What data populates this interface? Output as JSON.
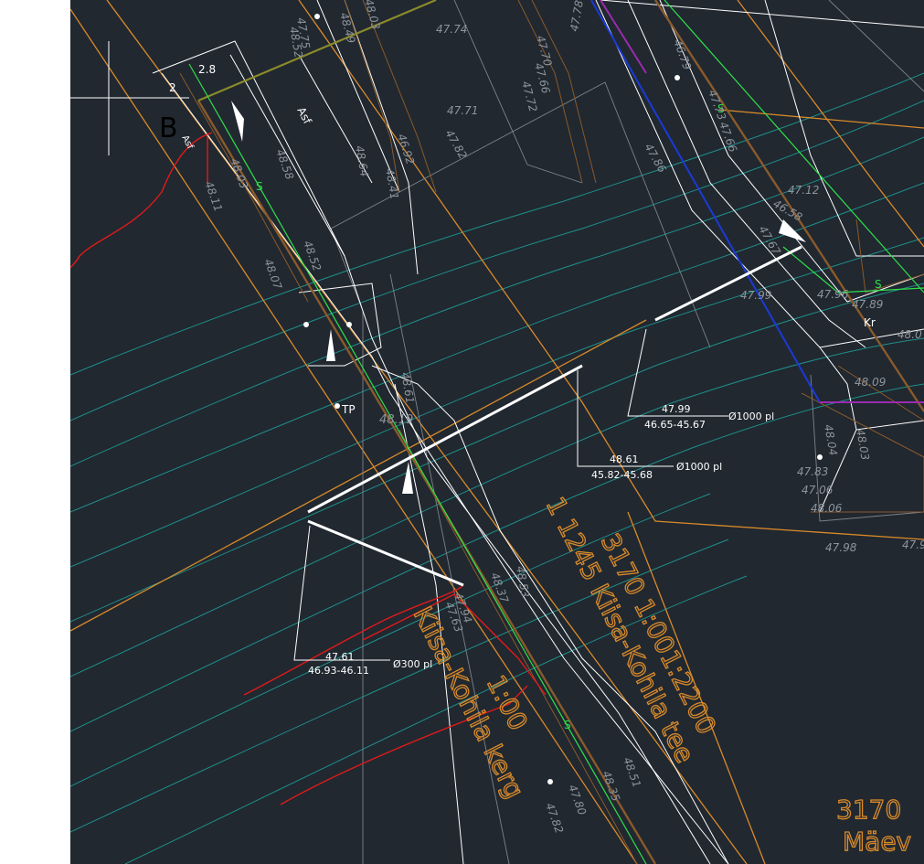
{
  "drawing": {
    "background": "#212830",
    "colors": {
      "orange": "#d98a2a",
      "brown": "#8a5a2b",
      "green": "#2ee04a",
      "teal": "#1f8f8a",
      "white": "#ffffff",
      "gray": "#8e949c",
      "blue": "#1a3ad8",
      "magenta": "#9b2bb0",
      "red": "#e01a1a"
    },
    "section_marker": "B",
    "labels": {
      "road_left": "1 1245 Kiisa-Kohila tee",
      "road_id": "3170 1:001:2200",
      "road_corner_id": "3170",
      "road_corner_name": "Mäev",
      "parcel_left": "Kiisa-Kohila kerg",
      "parcel_left_id": "1:00",
      "asphalt": "Asf",
      "asphalt_small": "Asf",
      "curb": "Kr",
      "tp": "TP",
      "sewer_s": "S",
      "dim_a": "2.8",
      "dim_b": "2"
    },
    "pipe_labels": [
      {
        "top": "47.99",
        "bottom": "46.65-45.67",
        "pipe": "Ø1000 pl"
      },
      {
        "top": "48.61",
        "bottom": "45.82-45.68",
        "pipe": "Ø1000 pl"
      },
      {
        "top": "47.61",
        "bottom": "46.93-46.11",
        "pipe": "Ø300 pl"
      }
    ],
    "elevations": [
      "47.74",
      "47.70",
      "47.66",
      "47.72",
      "47.71",
      "47.82",
      "46.92",
      "48.41",
      "48.64",
      "47.78",
      "46.79",
      "47.73",
      "47.66",
      "47.86",
      "47.12",
      "46.58",
      "47.67",
      "47.99",
      "47.96",
      "47.89",
      "48.0",
      "48.09",
      "48.04",
      "48.03",
      "47.83",
      "47.06",
      "48.06",
      "47.98",
      "47.9",
      "48.58",
      "48.52",
      "48.03",
      "48.11",
      "48.07",
      "48.19",
      "48.61",
      "48.53",
      "48.37",
      "47.63",
      "47.94",
      "48.51",
      "48.35",
      "47.80",
      "47.82",
      "47.75",
      "48.03",
      "48.49",
      "48.52"
    ]
  }
}
